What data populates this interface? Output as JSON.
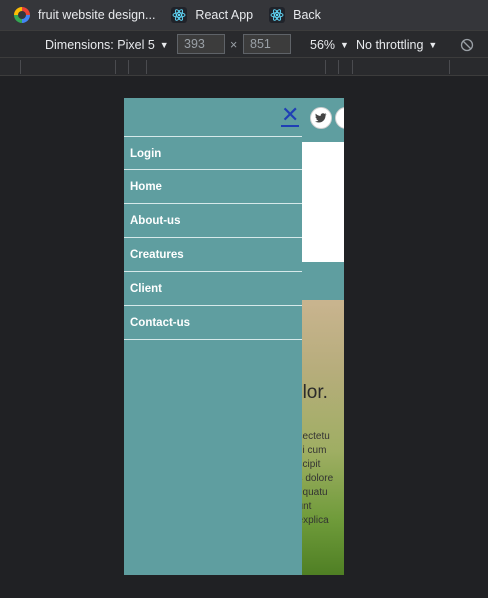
{
  "bookmarks": [
    {
      "label": "fruit website design...",
      "icon": "google-icon"
    },
    {
      "label": "React App",
      "icon": "react-icon"
    },
    {
      "label": "Back",
      "icon": "react-icon"
    }
  ],
  "device_toolbar": {
    "dimensions_label": "Dimensions: Pixel 5",
    "width": "393",
    "height": "851",
    "times": "×",
    "zoom": "56%",
    "throttling": "No throttling"
  },
  "site": {
    "nav_menu": {
      "close_symbol": "✕",
      "items": [
        "Login",
        "Home",
        "About-us",
        "Creatures",
        "Client",
        "Contact-us"
      ]
    },
    "hero_title": "olor.",
    "hero_lines": [
      "nsectetu",
      "imi cum",
      "uscipit",
      "us dolore",
      "sequatu",
      "dunt",
      ", explica"
    ]
  },
  "colors": {
    "drawer_bg": "#5f9ea0",
    "menu_text": "#ffffff",
    "close_icon": "#1f3fb5",
    "browser_bg": "#202124"
  }
}
